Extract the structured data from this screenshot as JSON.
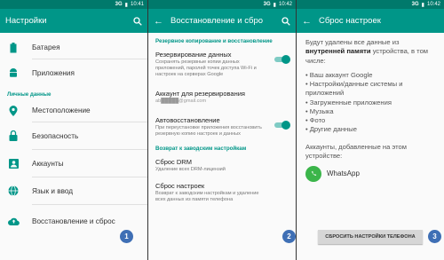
{
  "colors": {
    "primary": "#009688",
    "primary_dark": "#00796b",
    "badge": "#3f6fb5"
  },
  "status": {
    "network": "3G",
    "s1_time": "10:41",
    "s2_time": "10:42",
    "s3_time": "10:42"
  },
  "screen1": {
    "title": "Настройки",
    "items_top": [
      {
        "label": "Батарея",
        "icon": "battery-icon"
      },
      {
        "label": "Приложения",
        "icon": "android-icon"
      }
    ],
    "section": "Личные данные",
    "items": [
      {
        "label": "Местоположение",
        "icon": "location-icon"
      },
      {
        "label": "Безопасность",
        "icon": "lock-icon"
      },
      {
        "label": "Аккаунты",
        "icon": "account-icon"
      },
      {
        "label": "Язык и ввод",
        "icon": "globe-icon"
      },
      {
        "label": "Восстановление и сброс",
        "icon": "backup-icon"
      }
    ],
    "badge": "1"
  },
  "screen2": {
    "title": "Восстановление и сбро",
    "section1": "Резервное копирование и восстановление",
    "backup": {
      "title": "Резервирование данных",
      "desc": "Сохранять резервные копии данных приложений, паролей точек доступа Wi-Fi и настроек на серверах Google"
    },
    "account": {
      "title": "Аккаунт для резервирования",
      "desc": "ab█████@gmail.com"
    },
    "autorestore": {
      "title": "Автовосстановление",
      "desc": "При переустановке приложения восстановить резервную копию настроек и данных"
    },
    "section2": "Возврат к заводским настройкам",
    "drm": {
      "title": "Сброс DRM",
      "desc": "Удаление всех DRM-лицензий"
    },
    "reset": {
      "title": "Сброс настроек",
      "desc": "Возврат к заводским настройкам и удаление всех данных из памяти телефона"
    },
    "badge": "2"
  },
  "screen3": {
    "title": "Сброс настроек",
    "intro_pre": "Будут удалены все данные из ",
    "intro_bold": "внутренней памяти",
    "intro_post": " устройства, в том числе:",
    "list": [
      "Ваш аккаунт Google",
      "Настройки/данные системы и приложений",
      "Загруженные приложения",
      "Музыка",
      "Фото",
      "Другие данные"
    ],
    "accounts_text": "Аккаунты, добавленные на этом устройстве:",
    "app": "WhatsApp",
    "button": "СБРОСИТЬ НАСТРОЙКИ ТЕЛЕФОНА",
    "badge": "3"
  }
}
